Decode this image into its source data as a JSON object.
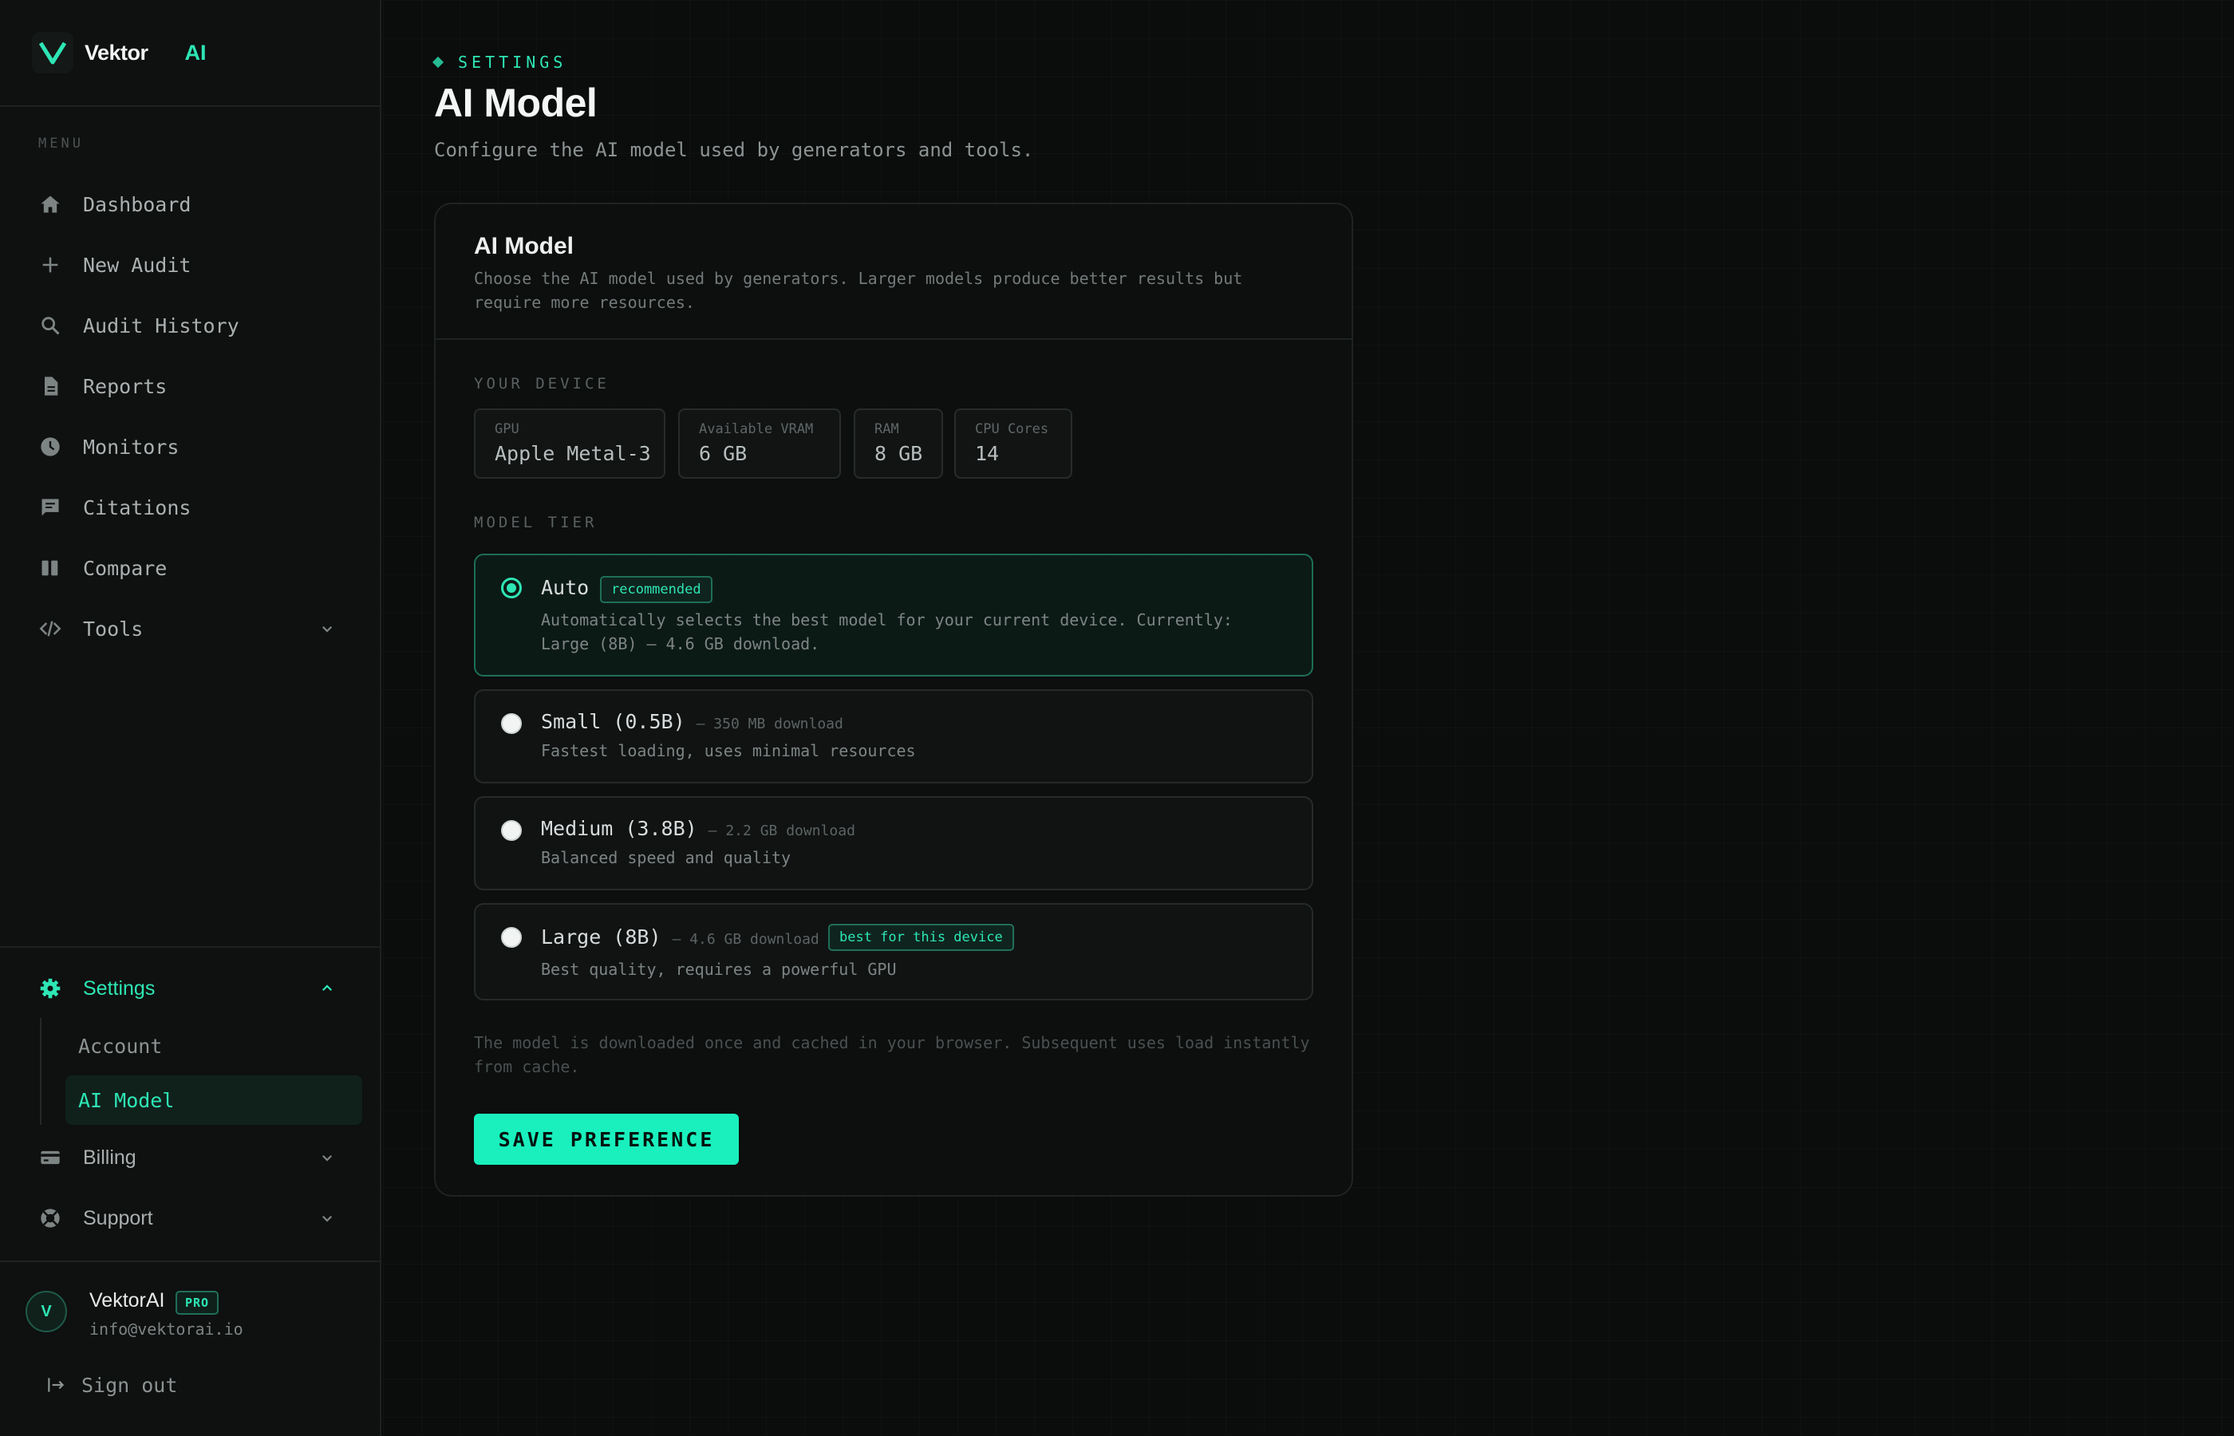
{
  "brand": {
    "name": "Vektor",
    "suffix": "AI",
    "logo_icon": "v-logo-icon",
    "accent": "#2ee6b5"
  },
  "sidebar": {
    "menu_label": "MENU",
    "items": [
      {
        "label": "Dashboard",
        "icon": "home-icon"
      },
      {
        "label": "New Audit",
        "icon": "plus-icon"
      },
      {
        "label": "Audit History",
        "icon": "search-icon"
      },
      {
        "label": "Reports",
        "icon": "document-icon"
      },
      {
        "label": "Monitors",
        "icon": "clock-icon"
      },
      {
        "label": "Citations",
        "icon": "comment-icon"
      },
      {
        "label": "Compare",
        "icon": "columns-icon"
      },
      {
        "label": "Tools",
        "icon": "code-icon",
        "expandable": true
      }
    ],
    "settings": {
      "label": "Settings",
      "icon": "gear-icon",
      "expanded": true,
      "children": [
        {
          "label": "Account",
          "active": false
        },
        {
          "label": "AI Model",
          "active": true
        }
      ]
    },
    "billing": {
      "label": "Billing",
      "icon": "credit-card-icon"
    },
    "support": {
      "label": "Support",
      "icon": "lifebuoy-icon"
    },
    "user": {
      "initial": "V",
      "name": "VektorAI",
      "badge": "PRO",
      "email": "info@vektorai.io"
    },
    "sign_out": {
      "label": "Sign out",
      "icon": "sign-out-icon"
    }
  },
  "header": {
    "breadcrumb": "SETTINGS",
    "title": "AI Model",
    "subtitle": "Configure the AI model used by generators and tools."
  },
  "card": {
    "title": "AI Model",
    "description": "Choose the AI model used by generators. Larger models produce better results but require more resources.",
    "device_label": "YOUR DEVICE",
    "device": [
      {
        "key": "GPU",
        "value": "Apple Metal-3"
      },
      {
        "key": "Available VRAM",
        "value": "6 GB"
      },
      {
        "key": "RAM",
        "value": "8 GB"
      },
      {
        "key": "CPU Cores",
        "value": "14"
      }
    ],
    "tier_label": "MODEL TIER",
    "options": [
      {
        "name": "Auto",
        "size": "",
        "badge": "recommended",
        "desc": "Automatically selects the best model for your current device. Currently: Large (8B) — 4.6 GB download.",
        "selected": true
      },
      {
        "name": "Small (0.5B)",
        "size": "— 350 MB download",
        "badge": "",
        "desc": "Fastest loading, uses minimal resources",
        "selected": false
      },
      {
        "name": "Medium (3.8B)",
        "size": "— 2.2 GB download",
        "badge": "",
        "desc": "Balanced speed and quality",
        "selected": false
      },
      {
        "name": "Large (8B)",
        "size": "— 4.6 GB download",
        "badge": "best for this device",
        "desc": "Best quality, requires a powerful GPU",
        "selected": false
      }
    ],
    "note": "The model is downloaded once and cached in your browser. Subsequent uses load instantly from cache.",
    "save_label": "SAVE PREFERENCE"
  }
}
